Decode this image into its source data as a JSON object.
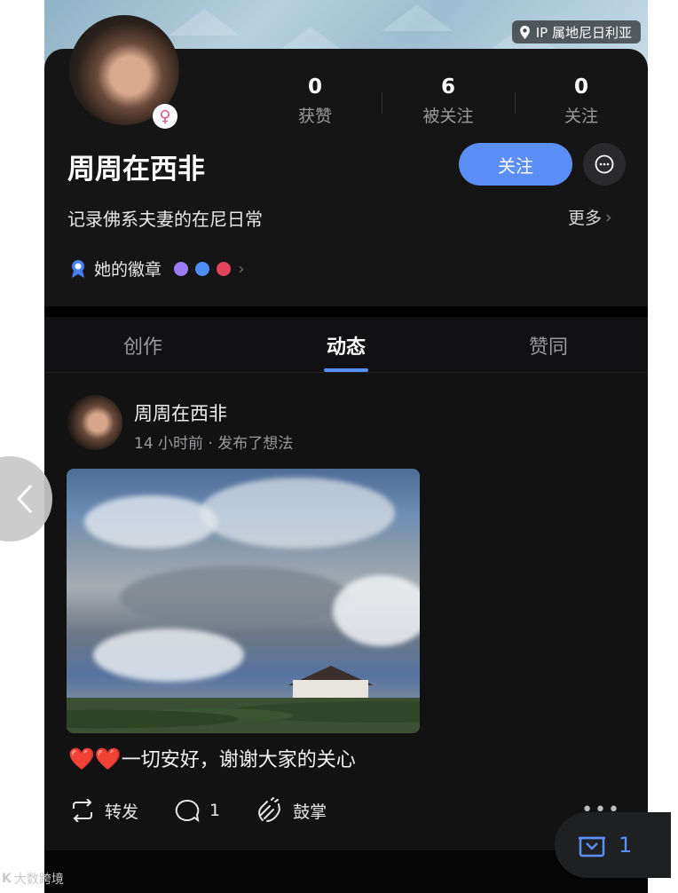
{
  "ip_location": "IP 属地尼日利亚",
  "profile": {
    "name": "周周在西非",
    "bio": "记录佛系夫妻的在尼日常",
    "more_label": "更多",
    "badges_label": "她的徽章",
    "stats": [
      {
        "value": "0",
        "label": "获赞"
      },
      {
        "value": "6",
        "label": "被关注"
      },
      {
        "value": "0",
        "label": "关注"
      }
    ],
    "follow_label": "关注"
  },
  "tabs": [
    {
      "label": "创作",
      "active": false
    },
    {
      "label": "动态",
      "active": true
    },
    {
      "label": "赞同",
      "active": false
    }
  ],
  "post": {
    "author": "周周在西非",
    "meta": "14 小时前 · 发布了想法",
    "hearts": "❤️❤️",
    "caption": "一切安好，谢谢大家的关心",
    "actions": {
      "repost_label": "转发",
      "comment_count": "1",
      "applaud_label": "鼓掌"
    }
  },
  "floating_badge": {
    "count": "1"
  },
  "watermark": "大数跨境",
  "colors": {
    "accent": "#5b8ef7",
    "background": "#0f0f10",
    "heart": "#e53935"
  }
}
